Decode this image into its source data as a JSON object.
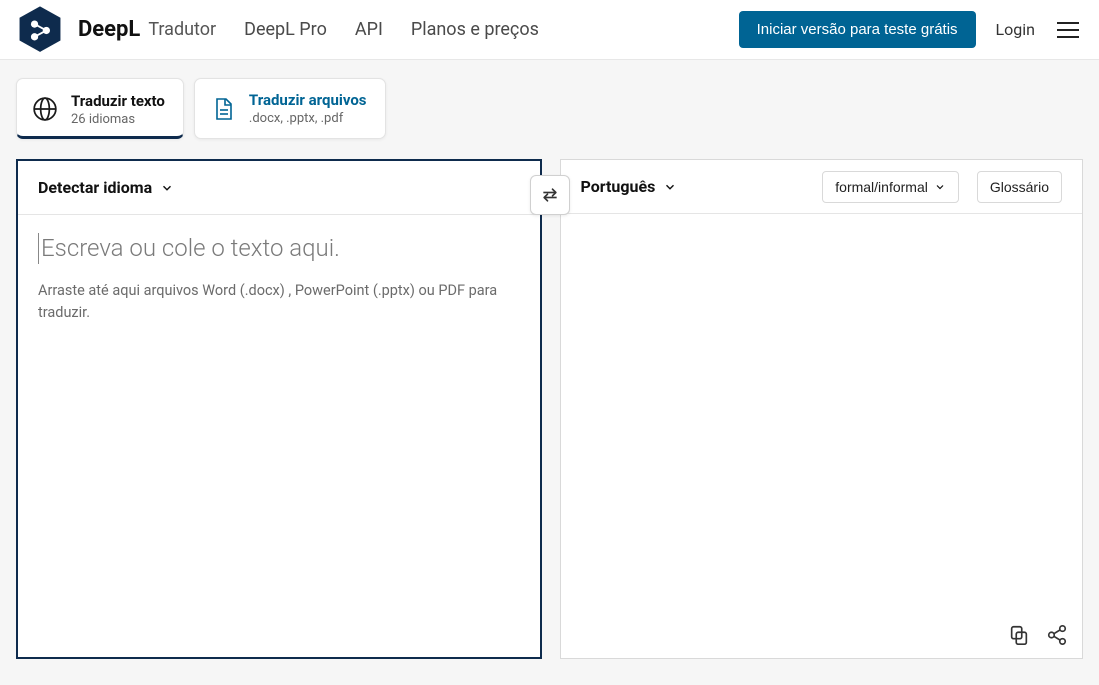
{
  "header": {
    "brand": "DeepL",
    "nav": {
      "translator": "Tradutor",
      "pro": "DeepL Pro",
      "api": "API",
      "plans": "Planos e preços"
    },
    "trial_button": "Iniciar versão para teste grátis",
    "login": "Login"
  },
  "tabs": {
    "text": {
      "title": "Traduzir texto",
      "subtitle": "26 idiomas"
    },
    "files": {
      "title": "Traduzir arquivos",
      "subtitle": ".docx, .pptx, .pdf"
    }
  },
  "source_panel": {
    "lang_label": "Detectar idioma",
    "placeholder": "Escreva ou cole o texto aqui.",
    "hint": "Arraste até aqui arquivos Word (.docx) , PowerPoint (.pptx) ou PDF para traduzir."
  },
  "target_panel": {
    "lang_label": "Português",
    "formality_label": "formal/informal",
    "glossary_label": "Glossário"
  }
}
